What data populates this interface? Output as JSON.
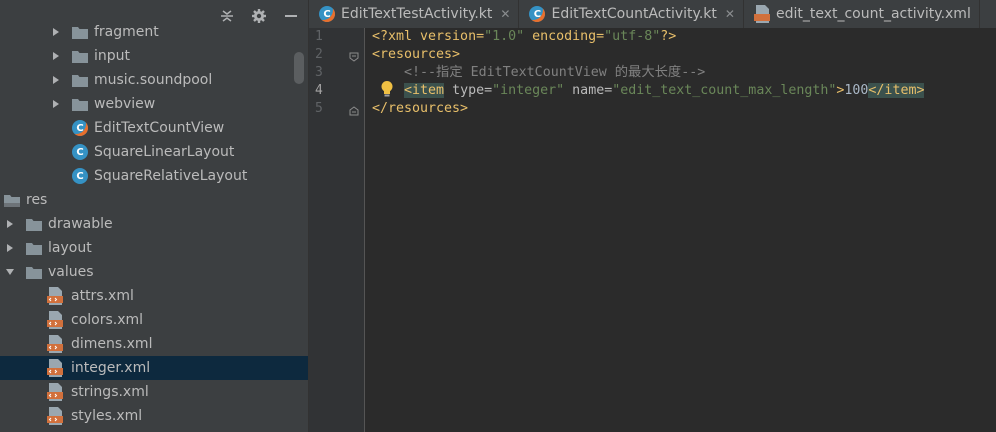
{
  "project_tree": {
    "items": [
      {
        "label": "fragment",
        "kind": "folder",
        "expandable": true
      },
      {
        "label": "input",
        "kind": "folder",
        "expandable": true
      },
      {
        "label": "music.soundpool",
        "kind": "folder",
        "expandable": true
      },
      {
        "label": "webview",
        "kind": "folder",
        "expandable": true
      },
      {
        "label": "EditTextCountView",
        "kind": "kotlin-class"
      },
      {
        "label": "SquareLinearLayout",
        "kind": "class"
      },
      {
        "label": "SquareRelativeLayout",
        "kind": "class"
      },
      {
        "label": "res",
        "kind": "res-folder"
      },
      {
        "label": "drawable",
        "kind": "folder",
        "expandable": true
      },
      {
        "label": "layout",
        "kind": "folder",
        "expandable": true
      },
      {
        "label": "values",
        "kind": "folder",
        "expanded": true
      },
      {
        "label": "attrs.xml",
        "kind": "xml"
      },
      {
        "label": "colors.xml",
        "kind": "xml"
      },
      {
        "label": "dimens.xml",
        "kind": "xml"
      },
      {
        "label": "integer.xml",
        "kind": "xml",
        "selected": true
      },
      {
        "label": "strings.xml",
        "kind": "xml"
      },
      {
        "label": "styles.xml",
        "kind": "xml"
      }
    ]
  },
  "toolbar": {
    "collapse_icon": "collapse-all-icon",
    "settings_icon": "gear-icon",
    "hide_icon": "minimize-icon"
  },
  "tabs": [
    {
      "label": "EditTextTestActivity.kt",
      "icon": "kotlin-class-icon",
      "active": false
    },
    {
      "label": "EditTextCountActivity.kt",
      "icon": "kotlin-class-icon",
      "active": false
    },
    {
      "label": "edit_text_count_activity.xml",
      "icon": "xml-file-icon",
      "active": false
    }
  ],
  "editor": {
    "line_numbers": [
      "1",
      "2",
      "3",
      "4",
      "5"
    ],
    "current_line": "4",
    "lines": [
      {
        "parts": [
          {
            "t": "<?xml version=",
            "c": "tag"
          },
          {
            "t": "\"1.0\"",
            "c": "str"
          },
          {
            "t": " encoding=",
            "c": "tag"
          },
          {
            "t": "\"utf-8\"",
            "c": "str"
          },
          {
            "t": "?>",
            "c": "tag"
          }
        ]
      },
      {
        "parts": [
          {
            "t": "<resources>",
            "c": "tag"
          }
        ]
      },
      {
        "parts": [
          {
            "t": "    <!--指定 EditTextCountView 的最大长度-->",
            "c": "comment"
          }
        ]
      },
      {
        "parts": [
          {
            "t": "    ",
            "c": "plain"
          },
          {
            "t": "<item",
            "c": "tag bg-tag"
          },
          {
            "t": " type=",
            "c": "attr"
          },
          {
            "t": "\"integer\"",
            "c": "str"
          },
          {
            "t": " name=",
            "c": "attr"
          },
          {
            "t": "\"edit_text_count_max_length\"",
            "c": "str"
          },
          {
            "t": ">",
            "c": "tag"
          },
          {
            "t": "100",
            "c": "plain"
          },
          {
            "t": "</item>",
            "c": "tag bg-tag"
          }
        ]
      },
      {
        "parts": [
          {
            "t": "</resources>",
            "c": "tag"
          }
        ]
      }
    ]
  },
  "colors": {
    "panel_bg": "#3c3f41",
    "editor_bg": "#2b2b2b",
    "selection": "#0d293e",
    "xml_tag": "#e8bf6a",
    "xml_string": "#6a8759",
    "comment": "#808080"
  }
}
